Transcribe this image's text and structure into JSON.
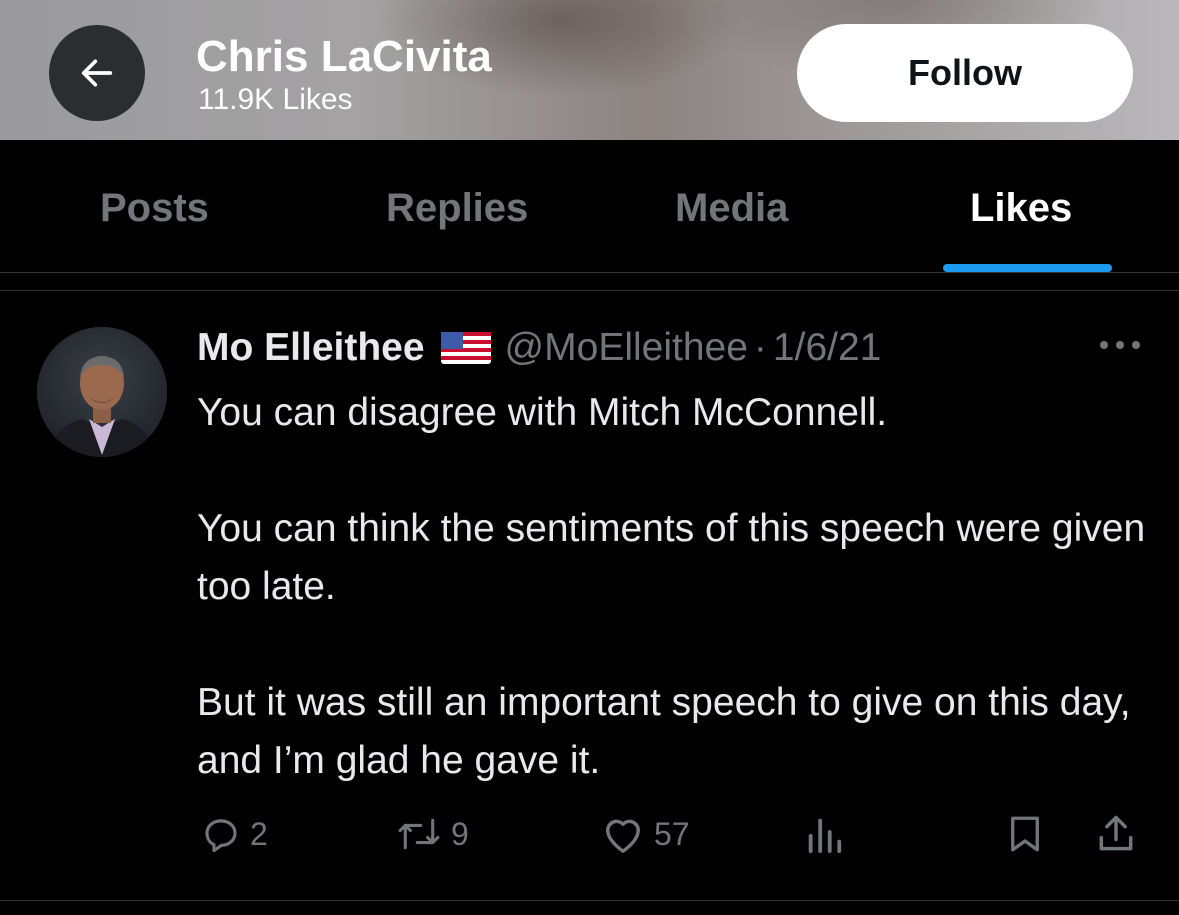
{
  "header": {
    "name": "Chris LaCivita",
    "likes_count": "11.9K Likes",
    "follow_label": "Follow",
    "back_icon": "arrow-left-icon"
  },
  "tabs": [
    {
      "label": "Posts",
      "active": false
    },
    {
      "label": "Replies",
      "active": false
    },
    {
      "label": "Media",
      "active": false
    },
    {
      "label": "Likes",
      "active": true
    }
  ],
  "tweet": {
    "author": "Mo Elleithee",
    "flag_icon": "us-flag-icon",
    "handle": "@MoElleithee",
    "separator": "·",
    "date": "1/6/21",
    "paragraphs": [
      "You can disagree with Mitch McConnell.",
      "You can think the sentiments of this speech were given too late.",
      "But it was still an important speech to give on this day, and I’m glad he gave it."
    ],
    "actions": {
      "replies": "2",
      "reposts": "9",
      "likes": "57"
    }
  },
  "colors": {
    "accent": "#1d9bf0",
    "muted": "#71767b",
    "text": "#e7e9ea",
    "background": "#000000"
  }
}
